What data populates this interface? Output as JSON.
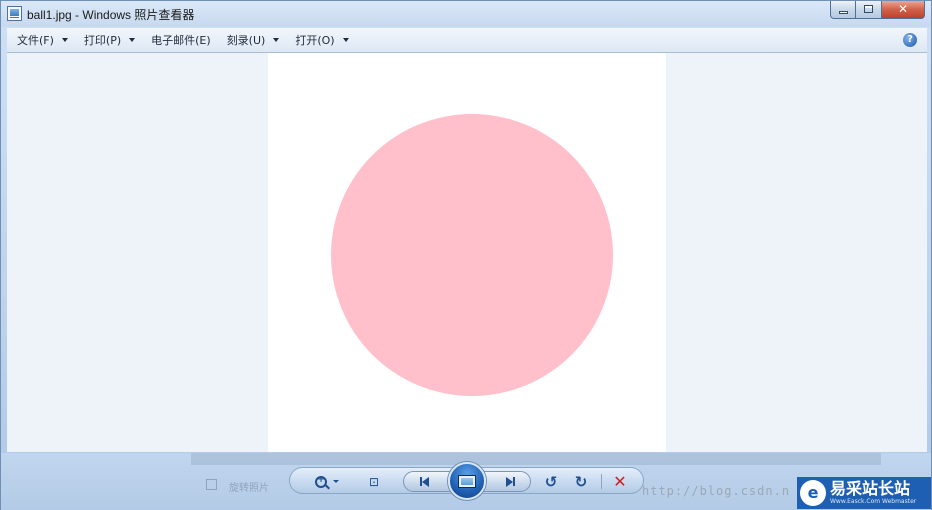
{
  "window": {
    "title": "ball1.jpg - Windows 照片查看器",
    "caption": {
      "close_glyph": "✕"
    }
  },
  "menu": {
    "items": [
      {
        "label": "文件(F)",
        "has_dropdown": true
      },
      {
        "label": "打印(P)",
        "has_dropdown": true
      },
      {
        "label": "电子邮件(E)",
        "has_dropdown": false
      },
      {
        "label": "刻录(U)",
        "has_dropdown": true
      },
      {
        "label": "打开(O)",
        "has_dropdown": true
      }
    ],
    "help_glyph": "?"
  },
  "image": {
    "shape": "circle",
    "fill_color": "#ffc0cb",
    "background_color": "#ffffff"
  },
  "toolbar": {
    "zoom": "zoom-icon",
    "fit_glyph": "⊡",
    "previous": "previous-icon",
    "slideshow": "slideshow-icon",
    "next": "next-icon",
    "rotate_left_glyph": "↺",
    "rotate_right_glyph": "↻",
    "delete_glyph": "✕"
  },
  "background_window": {
    "text": "旋转照片"
  },
  "watermark": {
    "url": "http://blog.csdn.n",
    "logo_mark": "e",
    "logo_cn": "易采站长站",
    "logo_en": "Www.Easck.Com Webmaster"
  },
  "colors": {
    "accent": "#1f4f8e",
    "delete": "#d02020",
    "logo_bg": "#1e5fb4"
  }
}
